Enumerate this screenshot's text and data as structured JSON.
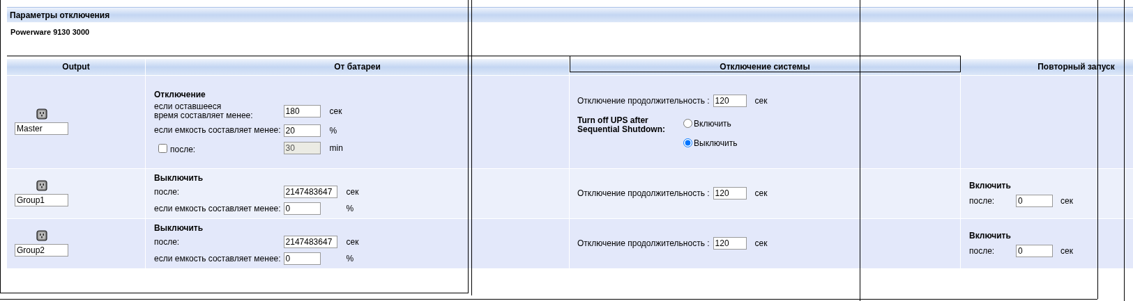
{
  "section_title": "Параметры отключения",
  "device": "Powerware 9130 3000",
  "columns": [
    "Output",
    "От батареи",
    "Отключение системы",
    "Повторный запуск"
  ],
  "rows": [
    {
      "output_name": "Master",
      "battery": {
        "heading": "Отключение",
        "fields": [
          {
            "kind": "input",
            "label": "если оставшееся\nвремя составляет менее:",
            "value": "180",
            "unit": "сек"
          },
          {
            "kind": "input",
            "label": "если емкость составляет менее:",
            "value": "20",
            "unit": "%"
          },
          {
            "kind": "checkbox",
            "checked": false,
            "label": "после:",
            "value": "30",
            "disabled": true,
            "unit": "min"
          }
        ]
      },
      "system": {
        "label": "Отключение продолжительность :",
        "value": "120",
        "unit": "сек",
        "turn_off": {
          "label": "Turn off UPS after\nSequential Shutdown:",
          "options": [
            {
              "label": "Включить",
              "selected": false
            },
            {
              "label": "Выключить",
              "selected": true
            }
          ]
        }
      }
    },
    {
      "output_name": "Group1",
      "battery": {
        "heading": "Выключить",
        "fields": [
          {
            "kind": "input",
            "label": "после:",
            "value": "2147483647",
            "unit": "сек"
          },
          {
            "kind": "input",
            "label": "если емкость составляет менее:",
            "value": "0",
            "unit": "%"
          }
        ]
      },
      "system": {
        "label": "Отключение продолжительность :",
        "value": "120",
        "unit": "сек"
      },
      "restart": {
        "heading": "Включить",
        "label": "после:",
        "value": "0",
        "unit": "сек"
      }
    },
    {
      "output_name": "Group2",
      "battery": {
        "heading": "Выключить",
        "fields": [
          {
            "kind": "input",
            "label": "после:",
            "value": "2147483647",
            "unit": "сек"
          },
          {
            "kind": "input",
            "label": "если емкость составляет менее:",
            "value": "0",
            "unit": "%"
          }
        ]
      },
      "system": {
        "label": "Отключение продолжительность :",
        "value": "120",
        "unit": "сек"
      },
      "restart": {
        "heading": "Включить",
        "label": "после:",
        "value": "0",
        "unit": "сек"
      }
    }
  ]
}
